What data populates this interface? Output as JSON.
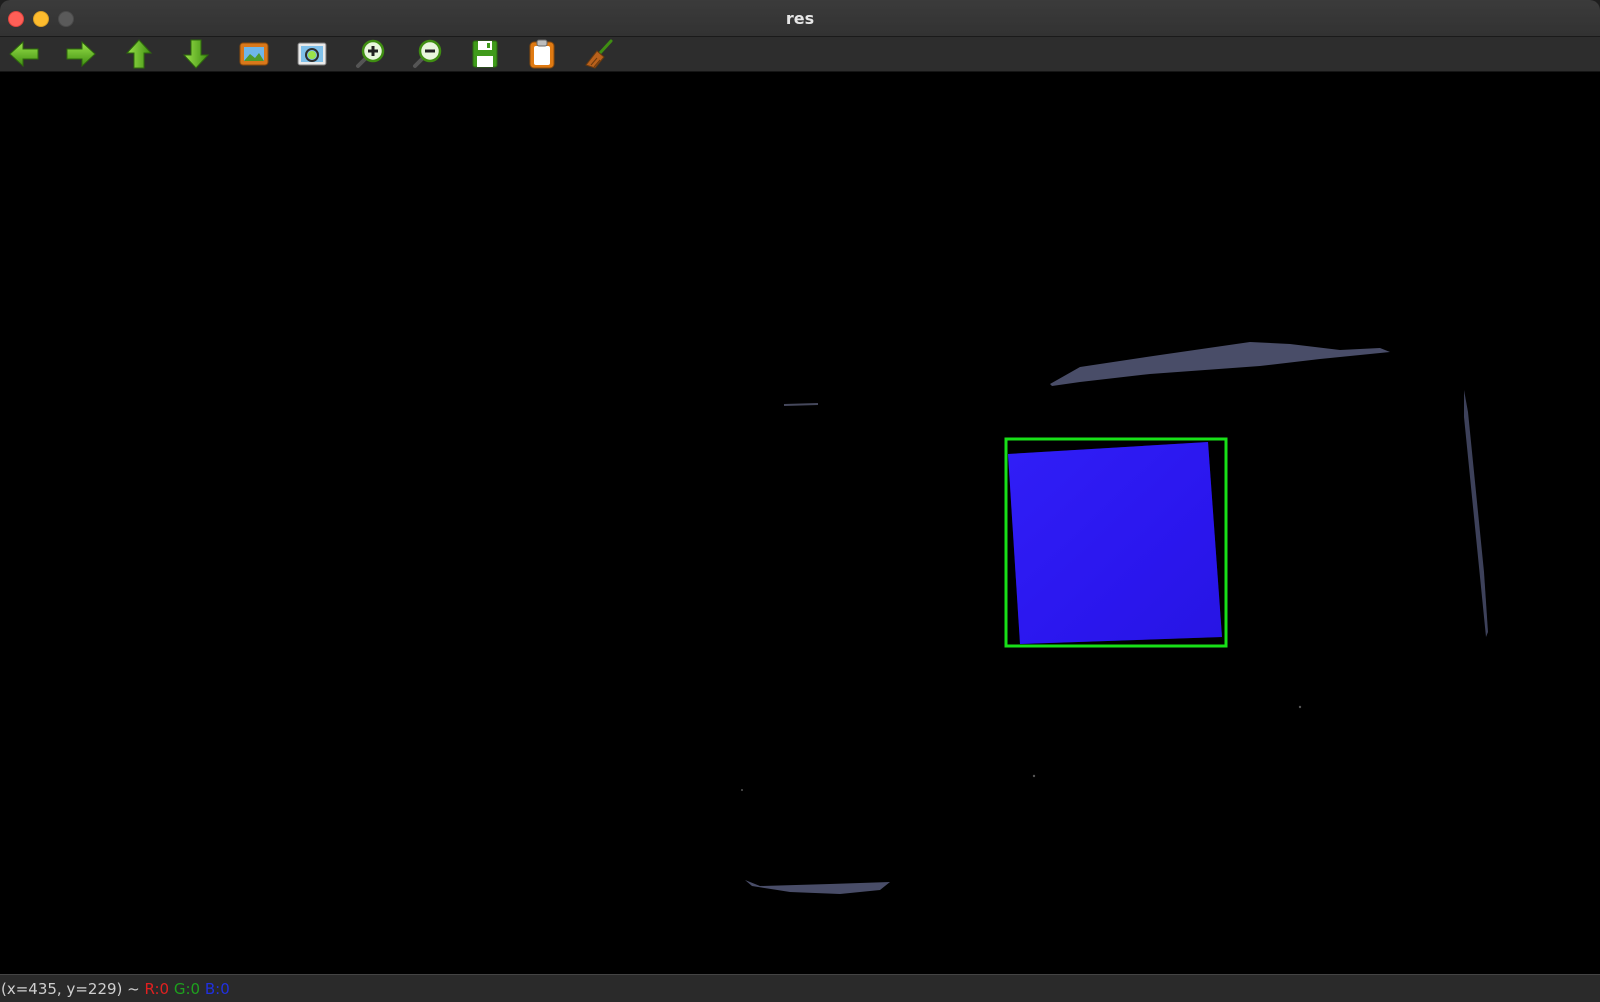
{
  "window": {
    "title": "res"
  },
  "toolbar": {
    "items": [
      {
        "icon": "arrow-left-icon"
      },
      {
        "icon": "arrow-right-icon"
      },
      {
        "icon": "arrow-up-icon"
      },
      {
        "icon": "arrow-down-icon"
      },
      {
        "icon": "image-icon"
      },
      {
        "icon": "zoom-fit-icon"
      },
      {
        "icon": "zoom-in-icon"
      },
      {
        "icon": "zoom-out-icon"
      },
      {
        "icon": "save-icon"
      },
      {
        "icon": "clipboard-icon"
      },
      {
        "icon": "broom-icon"
      }
    ]
  },
  "status": {
    "coords": "(x=435, y=229) ~",
    "r": "R:0",
    "g": "G:0",
    "b": "B:0"
  },
  "colors": {
    "detected_region": "#2b17f2",
    "bounding_box": "#18e018",
    "background": "#000000"
  }
}
